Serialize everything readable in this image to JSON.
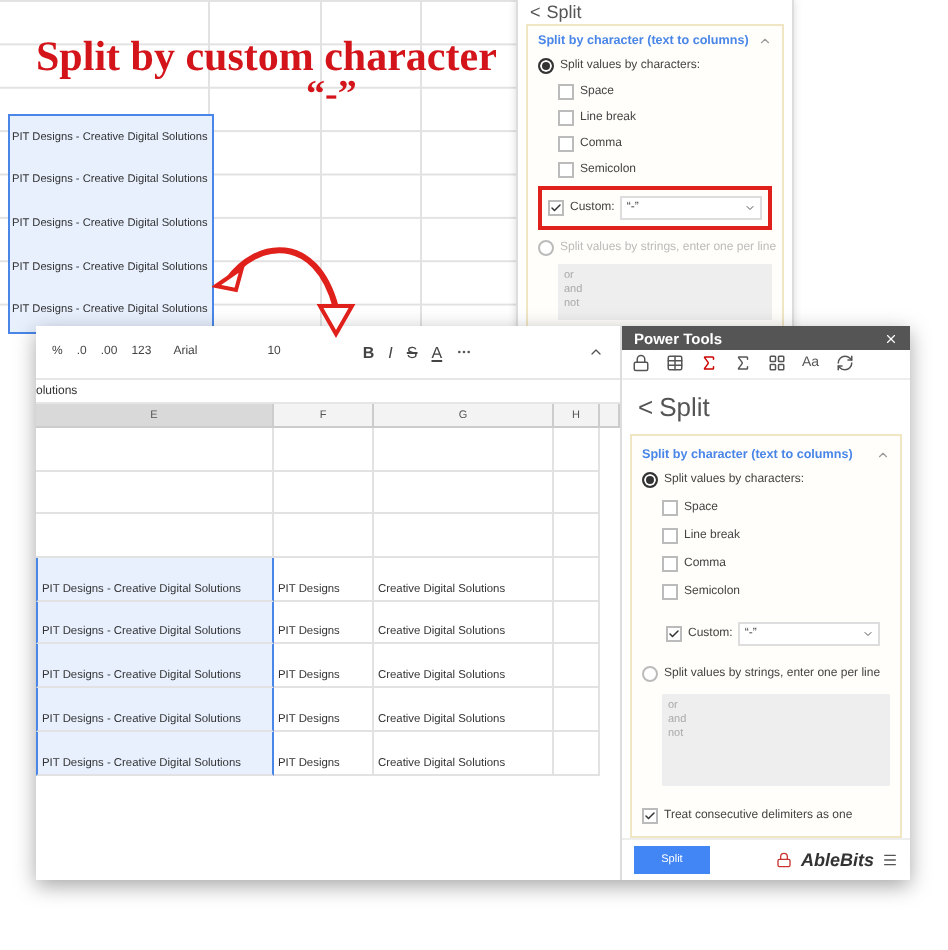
{
  "headline": {
    "title": "Split by custom character",
    "delimiter": "“-”"
  },
  "back_sheet": {
    "cells": [
      "PIT Designs - Creative Digital Solutions",
      "PIT Designs - Creative Digital Solutions",
      "PIT Designs - Creative Digital Solutions",
      "PIT Designs - Creative Digital Solutions",
      "PIT Designs - Creative Digital Solutions"
    ]
  },
  "back_panel": {
    "back": "<",
    "title": "Split",
    "section": "Split by character (text to columns)",
    "by_characters": {
      "label": "Split values by characters:",
      "selected": true
    },
    "options": [
      {
        "label": "Space",
        "checked": false
      },
      {
        "label": "Line break",
        "checked": false
      },
      {
        "label": "Comma",
        "checked": false
      },
      {
        "label": "Semicolon",
        "checked": false
      }
    ],
    "custom": {
      "label": "Custom:",
      "checked": true,
      "value": "“-”",
      "highlighted": true
    },
    "by_strings": {
      "label": "Split values by strings, enter one per line",
      "selected": false
    },
    "strings_placeholder": "or\nand\nnot"
  },
  "front_sheet": {
    "toolbar": [
      "%",
      ".0",
      ".00",
      "123",
      "Arial",
      "10",
      "B",
      "I",
      "S",
      "A"
    ],
    "formula": "olutions",
    "columns": [
      "E",
      "F",
      "G",
      "H"
    ],
    "rows": [
      {
        "e": "PIT Designs - Creative Digital Solutions",
        "f": "PIT Designs",
        "g": "Creative Digital Solutions"
      },
      {
        "e": "PIT Designs - Creative Digital Solutions",
        "f": "PIT Designs",
        "g": "Creative Digital Solutions"
      },
      {
        "e": "PIT Designs - Creative Digital Solutions",
        "f": "PIT Designs",
        "g": "Creative Digital Solutions"
      },
      {
        "e": "PIT Designs - Creative Digital Solutions",
        "f": "PIT Designs",
        "g": "Creative Digital Solutions"
      },
      {
        "e": "PIT Designs - Creative Digital Solutions",
        "f": "PIT Designs",
        "g": "Creative Digital Solutions"
      }
    ]
  },
  "power_tools": {
    "window_title": "Power Tools",
    "toolbar_text": "Aa",
    "back": "<",
    "title": "Split",
    "section": "Split by character (text to columns)",
    "by_characters": {
      "label": "Split values by characters:",
      "selected": true
    },
    "options": [
      {
        "label": "Space",
        "checked": false
      },
      {
        "label": "Line break",
        "checked": false
      },
      {
        "label": "Comma",
        "checked": false
      },
      {
        "label": "Semicolon",
        "checked": false
      }
    ],
    "custom": {
      "label": "Custom:",
      "checked": true,
      "value": "“-”",
      "highlighted": false
    },
    "by_strings": {
      "label": "Split values by strings, enter one per line",
      "selected": false
    },
    "strings_placeholder": "or\nand\nnot",
    "consecutive": {
      "label": "Treat consecutive delimiters as one",
      "checked": true
    },
    "button": "Split",
    "brand": "AbleBits"
  }
}
